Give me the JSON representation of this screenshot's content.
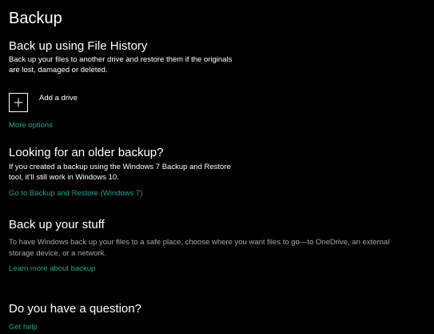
{
  "page": {
    "title": "Backup"
  },
  "file_history": {
    "heading": "Back up using File History",
    "description_line1": "Back up your files to another drive and restore them if the originals",
    "description_line2": "are lost, damaged or deleted.",
    "add_drive_label": "Add a drive",
    "more_options_link": "More options"
  },
  "older_backup": {
    "heading": "Looking for an older backup?",
    "description_line1": "If you created a backup using the Windows 7 Backup and Restore",
    "description_line2": "tool, it’ll still work in Windows 10.",
    "link": "Go to Backup and Restore (Windows 7)"
  },
  "backup_stuff": {
    "heading": "Back up your stuff",
    "description_line1": "To have Windows back up your files to a safe place, choose where you want files to go—to OneDrive, an external",
    "description_line2": "storage device, or a network.",
    "link": "Learn more about backup"
  },
  "question": {
    "heading": "Do you have a question?",
    "link": "Get help"
  },
  "colors": {
    "background": "#000000",
    "text": "#ffffff",
    "muted_text": "#a6a6a6",
    "link": "#1fa58d"
  },
  "icons": {
    "add_drive": "plus-icon"
  }
}
